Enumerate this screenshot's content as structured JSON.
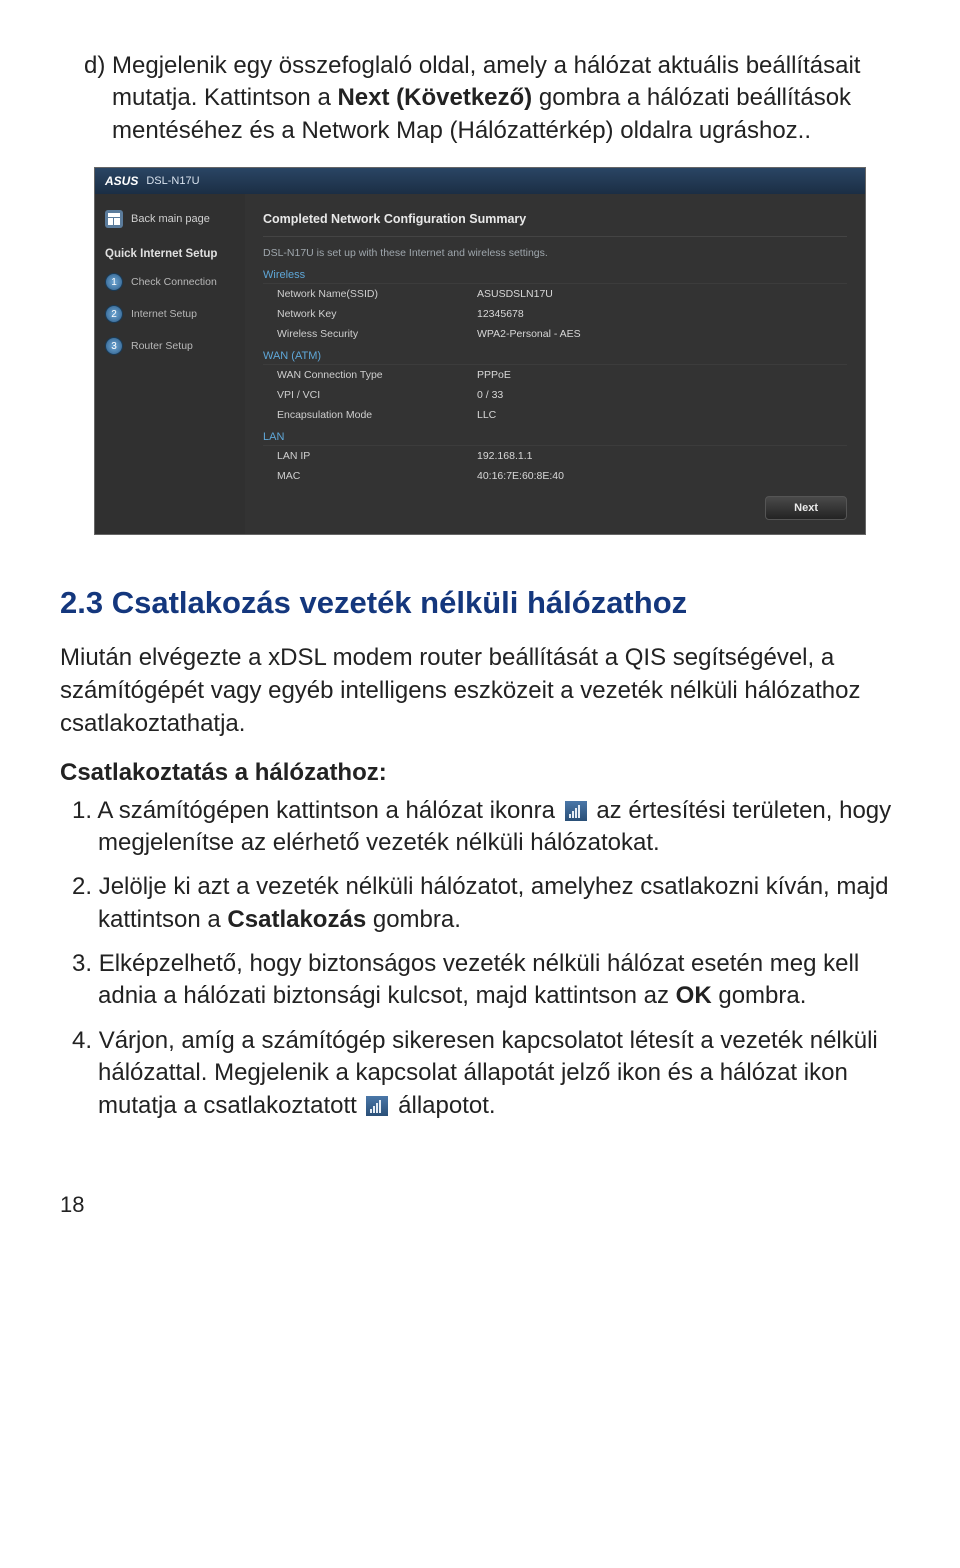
{
  "intro": {
    "bullet": "d)",
    "text_a": "Megjelenik egy összefoglaló oldal, amely a hálózat aktuális beállításait mutatja. Kattintson a ",
    "next_label": "Next (Következő)",
    "text_b": " gombra a hálózati beállítások mentéséhez és a Network Map (Hálózattérkép) oldalra ugráshoz.."
  },
  "router": {
    "titlebar_logo": "ASUS",
    "titlebar_model": "DSL-N17U",
    "sidebar": {
      "back": "Back main page",
      "qis_title": "Quick Internet Setup",
      "items": [
        {
          "num": "1",
          "label": "Check Connection"
        },
        {
          "num": "2",
          "label": "Internet Setup"
        },
        {
          "num": "3",
          "label": "Router Setup"
        }
      ]
    },
    "panel": {
      "title": "Completed Network Configuration Summary",
      "subtitle": "DSL-N17U is set up with these Internet and wireless settings.",
      "wireless_head": "Wireless",
      "wireless": [
        {
          "k": "Network Name(SSID)",
          "v": "ASUSDSLN17U"
        },
        {
          "k": "Network Key",
          "v": "12345678"
        },
        {
          "k": "Wireless Security",
          "v": "WPA2-Personal - AES"
        }
      ],
      "wan_head": "WAN (ATM)",
      "wan": [
        {
          "k": "WAN Connection Type",
          "v": "PPPoE"
        },
        {
          "k": "VPI / VCI",
          "v": "0 / 33"
        },
        {
          "k": "Encapsulation Mode",
          "v": "LLC"
        }
      ],
      "lan_head": "LAN",
      "lan": [
        {
          "k": "LAN IP",
          "v": "192.168.1.1"
        },
        {
          "k": "MAC",
          "v": "40:16:7E:60:8E:40"
        }
      ],
      "next_button": "Next"
    }
  },
  "section": {
    "heading": "2.3   Csatlakozás vezeték nélküli hálózathoz",
    "para": "Miután elvégezte a xDSL modem router beállítását a QIS segítségével, a számítógépét vagy egyéb intelligens eszközeit a vezeték nélküli hálózathoz csatlakoztathatja.",
    "subhead": "Csatlakoztatás a hálózathoz:"
  },
  "steps": {
    "s1": {
      "num": "1.",
      "a": "A számítógépen kattintson a hálózat ikonra ",
      "b": " az értesítési területen, hogy megjelenítse az elérhető vezeték nélküli hálózatokat."
    },
    "s2": {
      "num": "2.",
      "a": "Jelölje ki azt a vezeték nélküli hálózatot, amelyhez csatlakozni kíván, majd kattintson a ",
      "bold": "Csatlakozás",
      "b": " gombra."
    },
    "s3": {
      "num": "3.",
      "a": "Elképzelhető, hogy biztonságos vezeték nélküli hálózat esetén meg kell adnia a hálózati biztonsági kulcsot, majd kattintson az ",
      "bold": "OK",
      "b": " gombra."
    },
    "s4": {
      "num": "4.",
      "a": "Várjon, amíg a számítógép sikeresen kapcsolatot létesít a vezeték nélküli hálózattal. Megjelenik a kapcsolat állapotát jelző ikon és a hálózat ikon mutatja a csatlakoztatott ",
      "b": " állapotot."
    }
  },
  "pagenum": "18"
}
